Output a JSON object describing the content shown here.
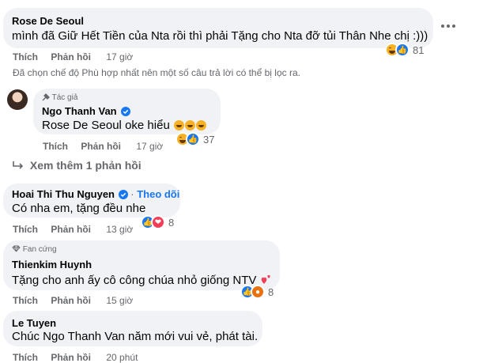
{
  "comments": [
    {
      "name": "Rose De Seoul",
      "text": "mình đã Giữ Hết Tiền của Nta rồi thì phải Tặng cho Nta đỡ tủi Thân Nhe chị :)))",
      "like_label": "Thích",
      "reply_label": "Phản hồi",
      "time": "17 giờ",
      "reaction_count": "81"
    },
    {
      "filter_notice": "Đã chọn chế độ Phù hợp nhất nên một số câu trả lời có thể bị lọc ra."
    },
    {
      "badge": "Tác giả",
      "name": "Ngo Thanh Van",
      "mention": "Rose De Seoul",
      "text": "oke hiểu",
      "like_label": "Thích",
      "reply_label": "Phản hồi",
      "time": "17 giờ",
      "reaction_count": "37"
    },
    {
      "more_replies": "Xem thêm 1 phản hồi"
    },
    {
      "name": "Hoai Thi Thu Nguyen",
      "follow": "Theo dõi",
      "text": "Có nha em, tặng đều nhe",
      "like_label": "Thích",
      "reply_label": "Phản hồi",
      "time": "13 giờ",
      "reaction_count": "8"
    },
    {
      "badge": "Fan cứng",
      "name": "Thienkim Huynh",
      "text": "Tặng cho anh ấy cô công chúa nhỏ giống NTV",
      "like_label": "Thích",
      "reply_label": "Phản hồi",
      "time": "15 giờ",
      "reaction_count": "8"
    },
    {
      "name": "Le Tuyen",
      "text": "Chúc Ngo Thanh Van năm mới vui vẻ, phát tài.",
      "like_label": "Thích",
      "reply_label": "Phản hồi",
      "time": "20 phút"
    }
  ],
  "icons": {
    "more": "more-options-icon",
    "verified": "verified-badge-icon",
    "author": "author-badge-icon",
    "fan": "diamond-icon",
    "reply_arrow": "reply-arrow-icon"
  },
  "colors": {
    "bubble": "#f0f2f5",
    "secondary_text": "#65676b",
    "link": "#1877f2",
    "like": "#1877f2",
    "love": "#f33e58",
    "haha": "#f7b125"
  }
}
